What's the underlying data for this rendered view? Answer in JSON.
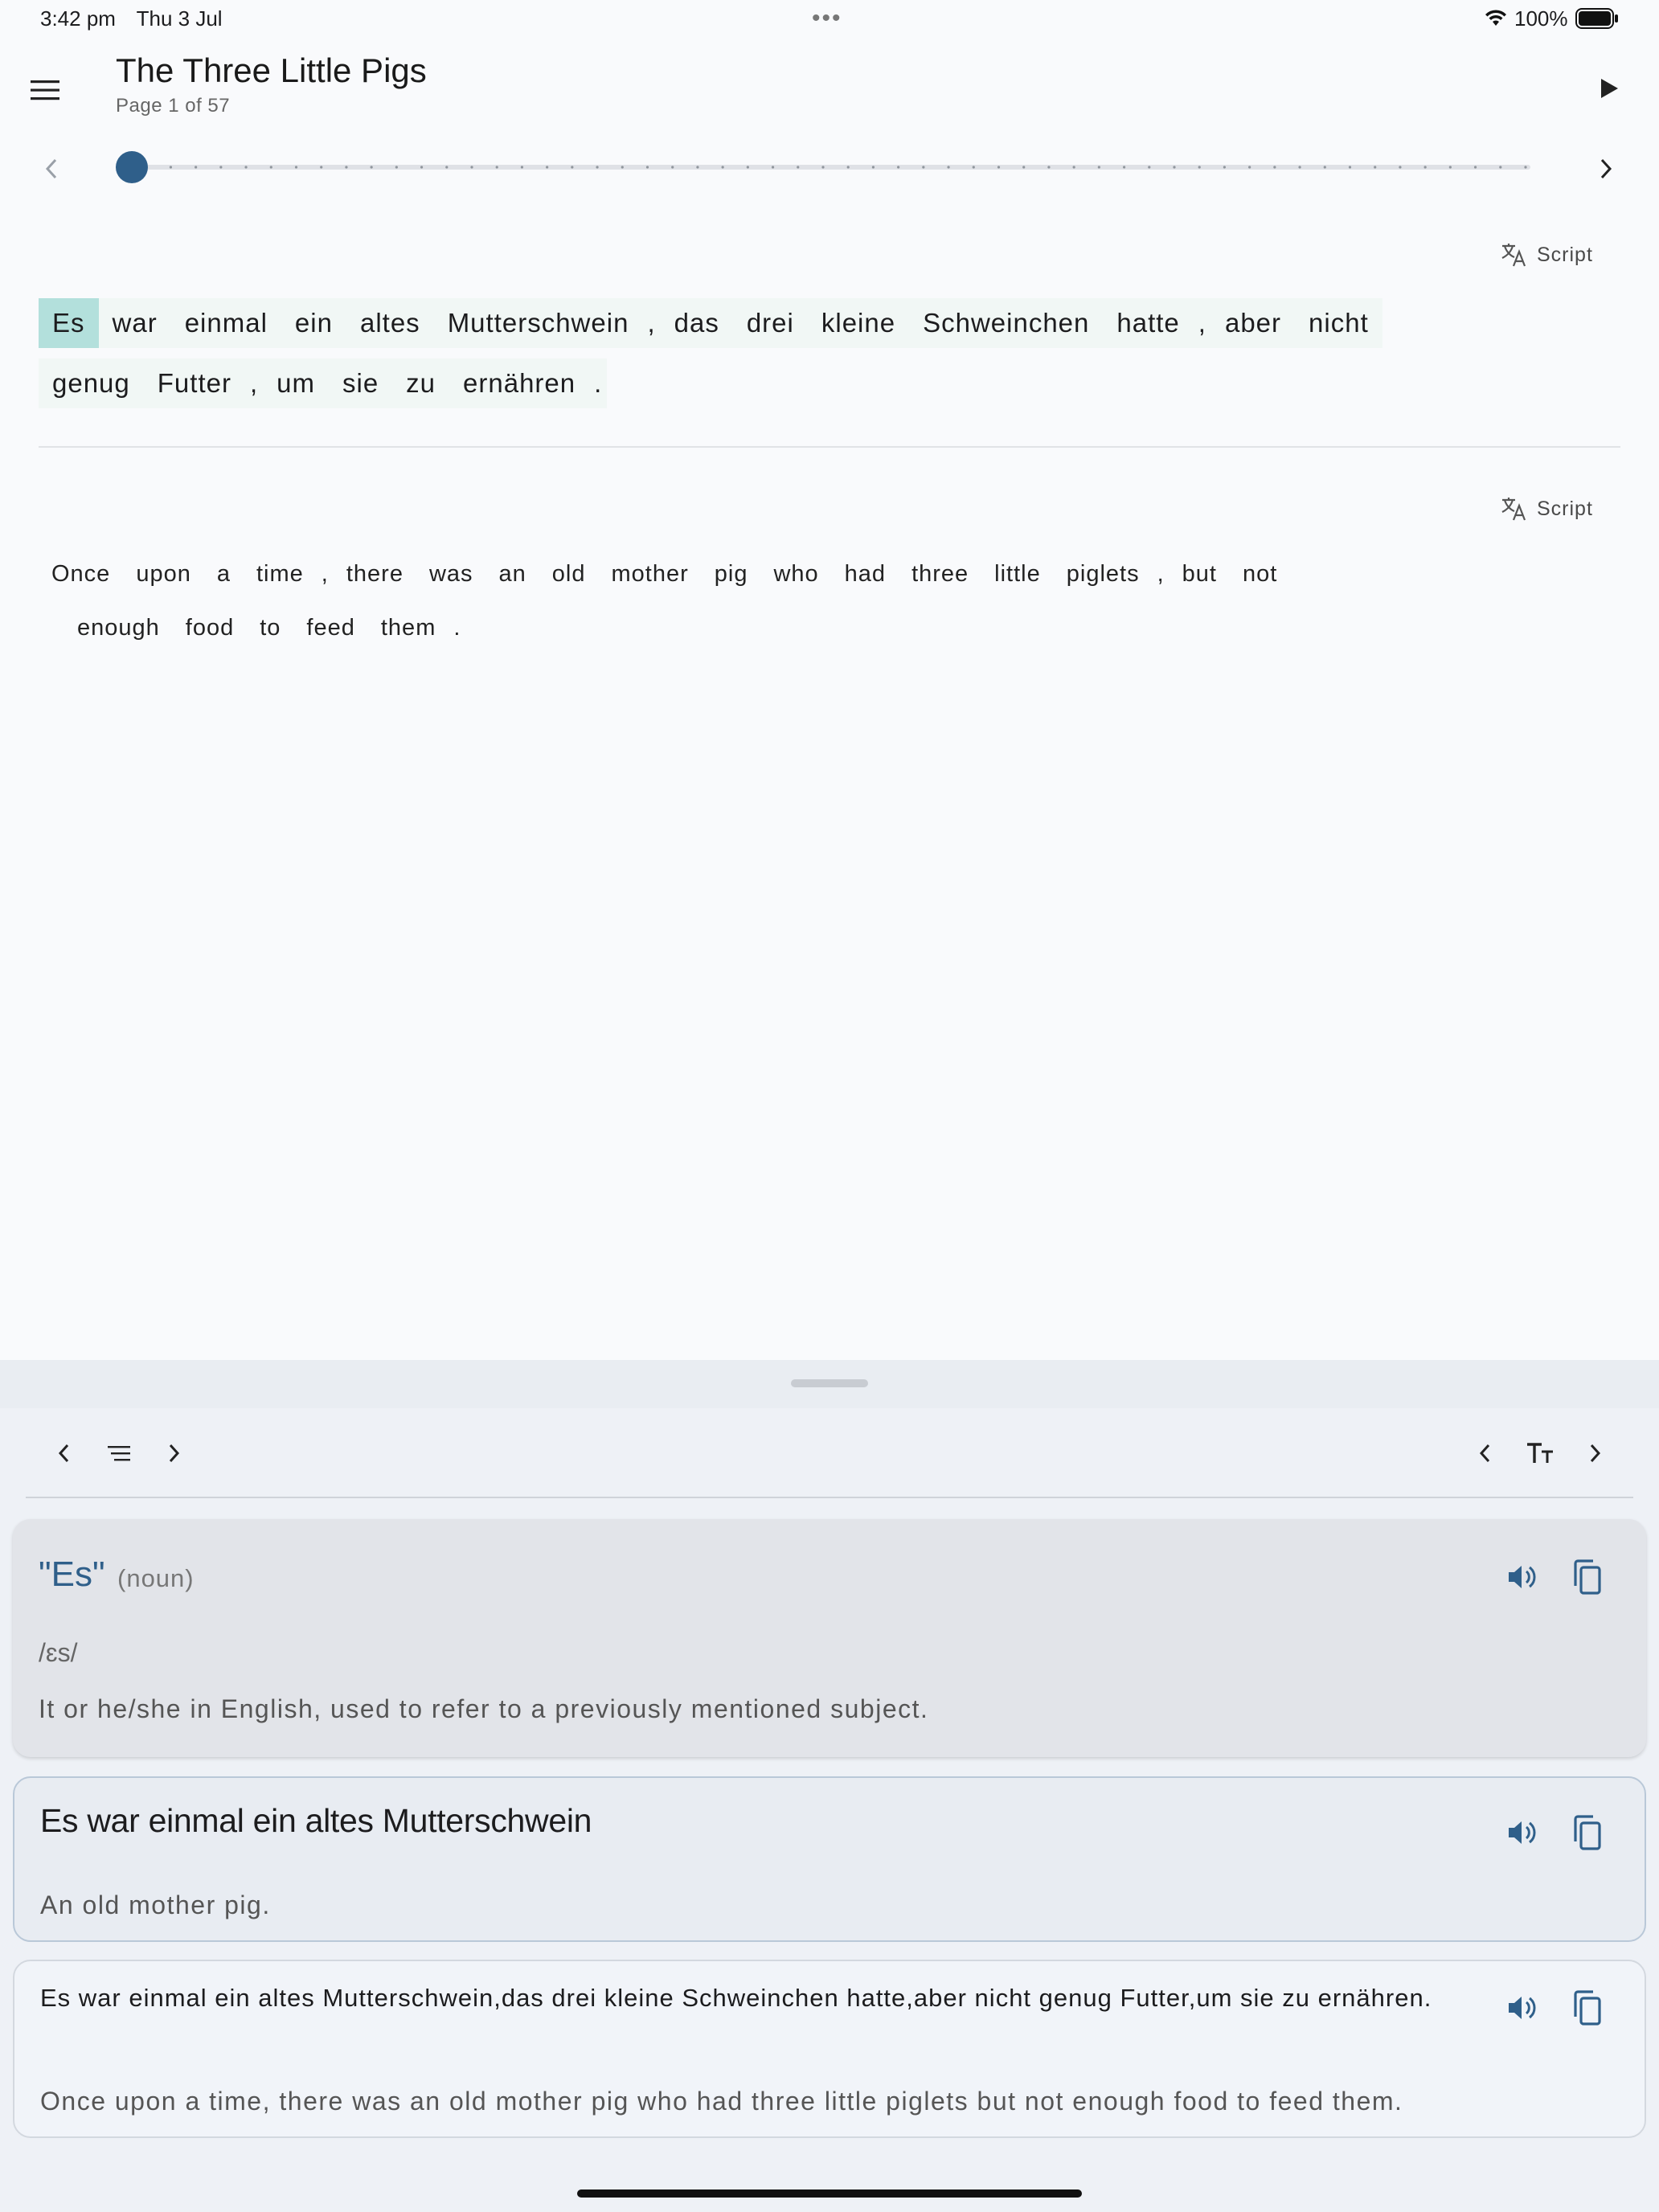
{
  "status_bar": {
    "time": "3:42 pm",
    "date": "Thu 3 Jul",
    "dots": "•••",
    "battery": "100%"
  },
  "header": {
    "title": "The Three Little Pigs",
    "page_indicator": "Page 1 of 57"
  },
  "slider": {
    "current_page": 1,
    "total_pages": 57
  },
  "script_label": "Script",
  "german_lines": [
    [
      "Es",
      "war",
      "einmal",
      "ein",
      "altes",
      "Mutterschwein",
      ",",
      "das",
      "drei",
      "kleine",
      "Schweinchen",
      "hatte",
      ",",
      "aber",
      "nicht"
    ],
    [
      "genug",
      "Futter",
      ",",
      "um",
      "sie",
      "zu",
      "ernähren",
      "."
    ]
  ],
  "english_lines": [
    [
      "Once",
      "upon",
      "a",
      "time",
      ",",
      "there",
      "was",
      "an",
      "old",
      "mother",
      "pig",
      "who",
      "had",
      "three",
      "little",
      "piglets",
      ",",
      "but",
      "not"
    ],
    [
      "enough",
      "food",
      "to",
      "feed",
      "them",
      "."
    ]
  ],
  "word_card": {
    "word": "\"Es\"",
    "part_of_speech": "(noun)",
    "ipa": "/ɛs/",
    "definition": "It or he/she in English, used to refer to a previously mentioned subject."
  },
  "phrase_card": {
    "phrase": "Es war einmal ein altes Mutterschwein",
    "translation": "An old mother pig."
  },
  "sentence_card": {
    "sentence": "Es war einmal ein altes Mutterschwein,das drei kleine Schweinchen hatte,aber nicht genug Futter,um sie zu ernähren.",
    "translation": "Once upon a time, there was an old mother pig who had three little piglets but not enough food to feed them."
  },
  "colors": {
    "accent": "#2f5f8a",
    "active_word_bg": "#b3e0dc",
    "highlight_bg": "#f1f7f5"
  }
}
